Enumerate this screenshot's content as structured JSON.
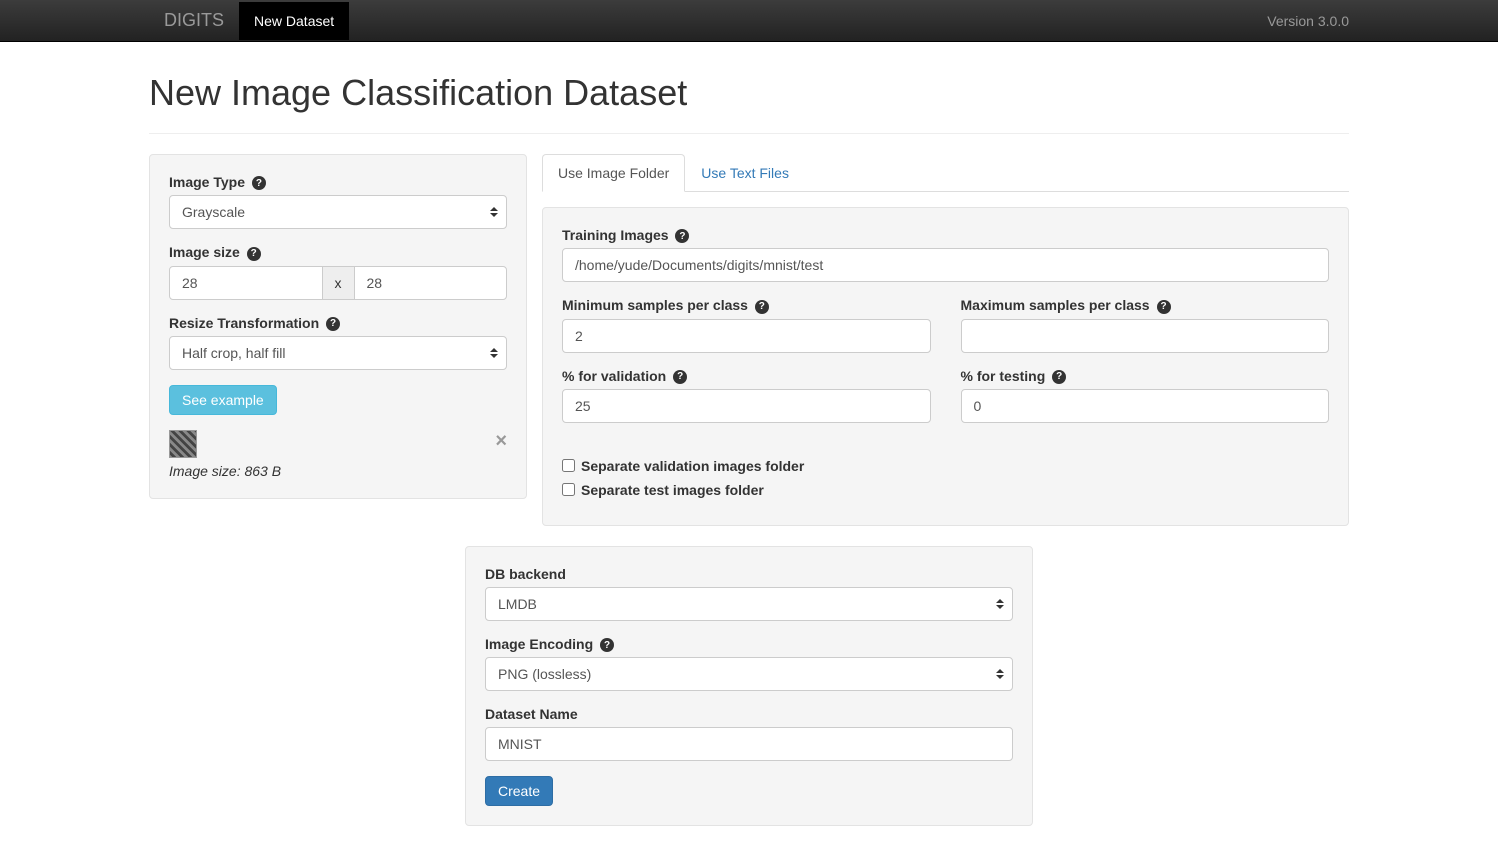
{
  "navbar": {
    "brand": "DIGITS",
    "active_item": "New Dataset",
    "version": "Version 3.0.0"
  },
  "page_title": "New Image Classification Dataset",
  "left_panel": {
    "image_type_label": "Image Type",
    "image_type_value": "Grayscale",
    "image_size_label": "Image size",
    "image_width": "28",
    "image_height": "28",
    "size_separator": "x",
    "resize_label": "Resize Transformation",
    "resize_value": "Half crop, half fill",
    "see_example_btn": "See example",
    "image_size_text": "Image size: 863 B",
    "close_symbol": "×"
  },
  "tabs": {
    "tab1": "Use Image Folder",
    "tab2": "Use Text Files"
  },
  "folder_tab": {
    "training_images_label": "Training Images",
    "training_images_value": "/home/yude/Documents/digits/mnist/test",
    "min_samples_label": "Minimum samples per class",
    "min_samples_value": "2",
    "max_samples_label": "Maximum samples per class",
    "max_samples_value": "",
    "pct_validation_label": "% for validation",
    "pct_validation_value": "25",
    "pct_testing_label": "% for testing",
    "pct_testing_value": "0",
    "separate_validation_label": "Separate validation images folder",
    "separate_test_label": "Separate test images folder"
  },
  "bottom_panel": {
    "db_backend_label": "DB backend",
    "db_backend_value": "LMDB",
    "image_encoding_label": "Image Encoding",
    "image_encoding_value": "PNG (lossless)",
    "dataset_name_label": "Dataset Name",
    "dataset_name_value": "MNIST",
    "create_btn": "Create"
  }
}
